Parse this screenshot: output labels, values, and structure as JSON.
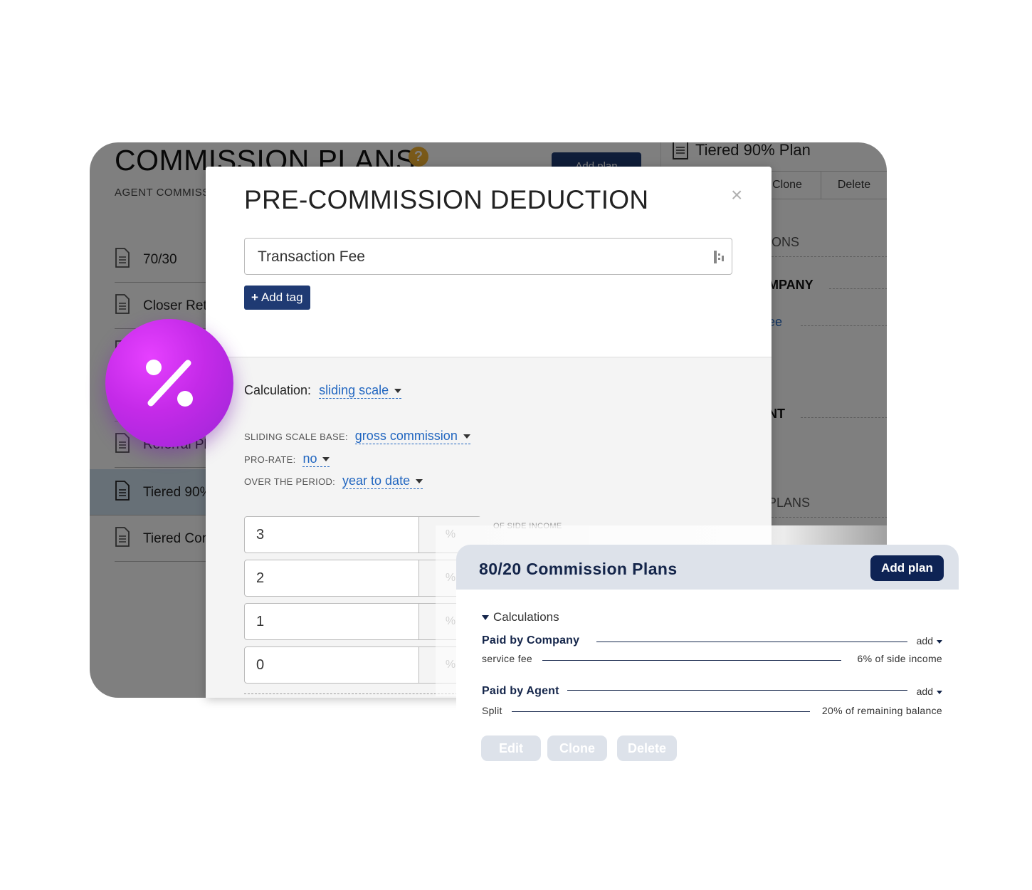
{
  "background_app": {
    "title": "COMMISSION PLANS",
    "add_plan_label": "Add plan",
    "subtitle": "AGENT COMMISS",
    "plans": [
      {
        "label": "70/30",
        "selected": false
      },
      {
        "label": "Closer Ret",
        "selected": false
      },
      {
        "label": "",
        "selected": false
      },
      {
        "label": "",
        "selected": false
      },
      {
        "label": "Referral Pl",
        "selected": false
      },
      {
        "label": "Tiered 90%",
        "selected": true
      },
      {
        "label": "Tiered Cor",
        "selected": false
      }
    ],
    "side_panel": {
      "title": "Tiered 90% Plan",
      "clone_label": "Clone",
      "delete_label": "Delete",
      "section_calc": "IONS",
      "row_company": "MPANY",
      "row_fee": "ee",
      "row_agent": "NT",
      "section_plans": "PLANS"
    }
  },
  "modal": {
    "title": "PRE-COMMISSION DEDUCTION",
    "close_glyph": "×",
    "name_value": "Transaction Fee",
    "add_tag_label": "Add tag",
    "calculation_label": "Calculation:",
    "calculation_value": "sliding scale",
    "sliding_scale_base_label": "SLIDING SCALE BASE:",
    "sliding_scale_base_value": "gross commission",
    "pro_rate_label": "PRO-RATE:",
    "pro_rate_value": "no",
    "period_label": "OVER THE PERIOD:",
    "period_value": "year to date",
    "tiers": [
      {
        "value": "3",
        "unit": "%"
      },
      {
        "value": "2",
        "unit": "%"
      },
      {
        "value": "1",
        "unit": "%"
      },
      {
        "value": "0",
        "unit": "%"
      }
    ],
    "tier_note": "OF SIDE INCOME"
  },
  "card": {
    "title": "80/20 Commission Plans",
    "add_plan_label": "Add plan",
    "calculations_label": "Calculations",
    "paid_by_company_label": "Paid by Company",
    "company_add_label": "add",
    "service_fee_label": "service fee",
    "service_fee_value": "6% of side income",
    "paid_by_agent_label": "Paid by Agent",
    "agent_add_label": "add",
    "split_label": "Split",
    "split_value": "20% of remaining balance",
    "edit_label": "Edit",
    "clone_label": "Clone",
    "delete_label": "Delete"
  },
  "icons": {
    "badge": "percent-icon",
    "help": "help-icon",
    "plan": "document-icon"
  },
  "colors": {
    "navy": "#0e2354",
    "link_blue": "#2166c0",
    "badge_purple": "#c42ae8",
    "help_orange": "#f2b233"
  }
}
